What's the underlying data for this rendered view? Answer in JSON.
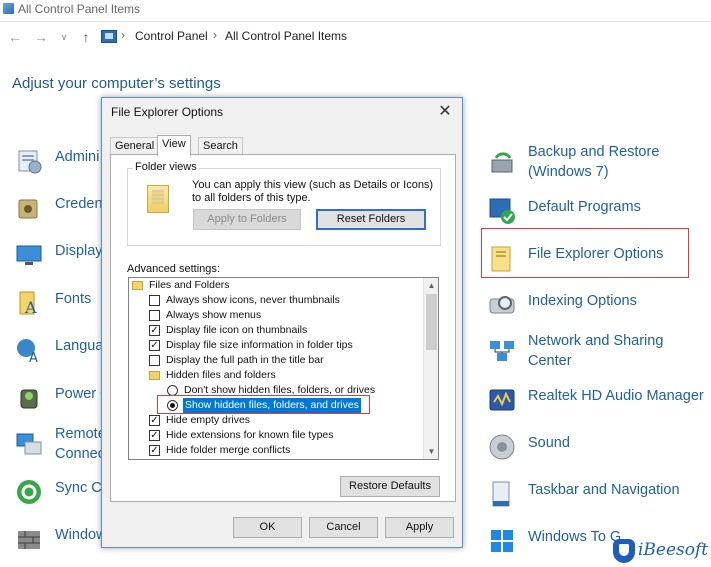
{
  "window": {
    "title": "All Control Panel Items"
  },
  "address_bar": {
    "back_icon": "arrow-left-icon",
    "forward_icon": "arrow-right-icon",
    "up_icon": "arrow-up-icon",
    "crumbs": [
      "Control Panel",
      "All Control Panel Items"
    ]
  },
  "page_heading": "Adjust your computer’s settings",
  "left_items": [
    {
      "label": "Admini",
      "icon": "administrative-tools-icon"
    },
    {
      "label": "Creden",
      "icon": "credential-manager-icon"
    },
    {
      "label": "Display",
      "icon": "display-icon"
    },
    {
      "label": "Fonts",
      "icon": "fonts-icon"
    },
    {
      "label": "Langua",
      "icon": "language-icon"
    },
    {
      "label": "Power O",
      "icon": "power-options-icon"
    },
    {
      "label": "Remote",
      "label2": "Connec",
      "icon": "remote-connections-icon"
    },
    {
      "label": "Sync Ce",
      "icon": "sync-center-icon"
    },
    {
      "label": "Window",
      "icon": "windows-firewall-icon"
    }
  ],
  "right_items": [
    {
      "label": "Backup and Restore",
      "label2": "(Windows 7)",
      "icon": "backup-restore-icon"
    },
    {
      "label": "Default Programs",
      "icon": "default-programs-icon"
    },
    {
      "label": "File Explorer Options",
      "icon": "folder-options-icon"
    },
    {
      "label": "Indexing Options",
      "icon": "indexing-options-icon"
    },
    {
      "label": "Network and Sharing",
      "label2": "Center",
      "icon": "network-sharing-icon"
    },
    {
      "label": "Realtek HD Audio Manager",
      "icon": "realtek-audio-icon"
    },
    {
      "label": "Sound",
      "icon": "sound-icon"
    },
    {
      "label": "Taskbar and Navigation",
      "icon": "taskbar-icon"
    },
    {
      "label": "Windows To G",
      "icon": "windows-to-go-icon"
    }
  ],
  "dialog": {
    "title": "File Explorer Options",
    "close_icon": "close-icon",
    "tabs": [
      "General",
      "View",
      "Search"
    ],
    "active_tab": "View",
    "folder_views": {
      "title": "Folder views",
      "description": "You can apply this view (such as Details or Icons) to all folders of this type.",
      "apply_button": "Apply to Folders",
      "reset_button": "Reset Folders"
    },
    "advanced_label": "Advanced settings:",
    "tree": [
      {
        "type": "folder",
        "indent": 0,
        "label": "Files and Folders"
      },
      {
        "type": "checkbox",
        "indent": 1,
        "checked": false,
        "label": "Always show icons, never thumbnails"
      },
      {
        "type": "checkbox",
        "indent": 1,
        "checked": false,
        "label": "Always show menus"
      },
      {
        "type": "checkbox",
        "indent": 1,
        "checked": true,
        "label": "Display file icon on thumbnails"
      },
      {
        "type": "checkbox",
        "indent": 1,
        "checked": true,
        "label": "Display file size information in folder tips"
      },
      {
        "type": "checkbox",
        "indent": 1,
        "checked": false,
        "label": "Display the full path in the title bar"
      },
      {
        "type": "folder",
        "indent": 1,
        "label": "Hidden files and folders"
      },
      {
        "type": "radio",
        "indent": 2,
        "checked": false,
        "label": "Don't show hidden files, folders, or drives"
      },
      {
        "type": "radio",
        "indent": 2,
        "checked": true,
        "selected": true,
        "label": "Show hidden files, folders, and drives"
      },
      {
        "type": "checkbox",
        "indent": 1,
        "checked": true,
        "label": "Hide empty drives"
      },
      {
        "type": "checkbox",
        "indent": 1,
        "checked": true,
        "label": "Hide extensions for known file types"
      },
      {
        "type": "checkbox",
        "indent": 1,
        "checked": true,
        "label": "Hide folder merge conflicts"
      }
    ],
    "restore_button": "Restore Defaults",
    "ok_button": "OK",
    "cancel_button": "Cancel",
    "apply_button": "Apply"
  },
  "watermark": "iBeesoft",
  "colors": {
    "link_blue": "#1f5f9e",
    "highlight_red": "#e23a3a",
    "selection_blue": "#0078d7",
    "dialog_border": "#5b8fc9"
  }
}
